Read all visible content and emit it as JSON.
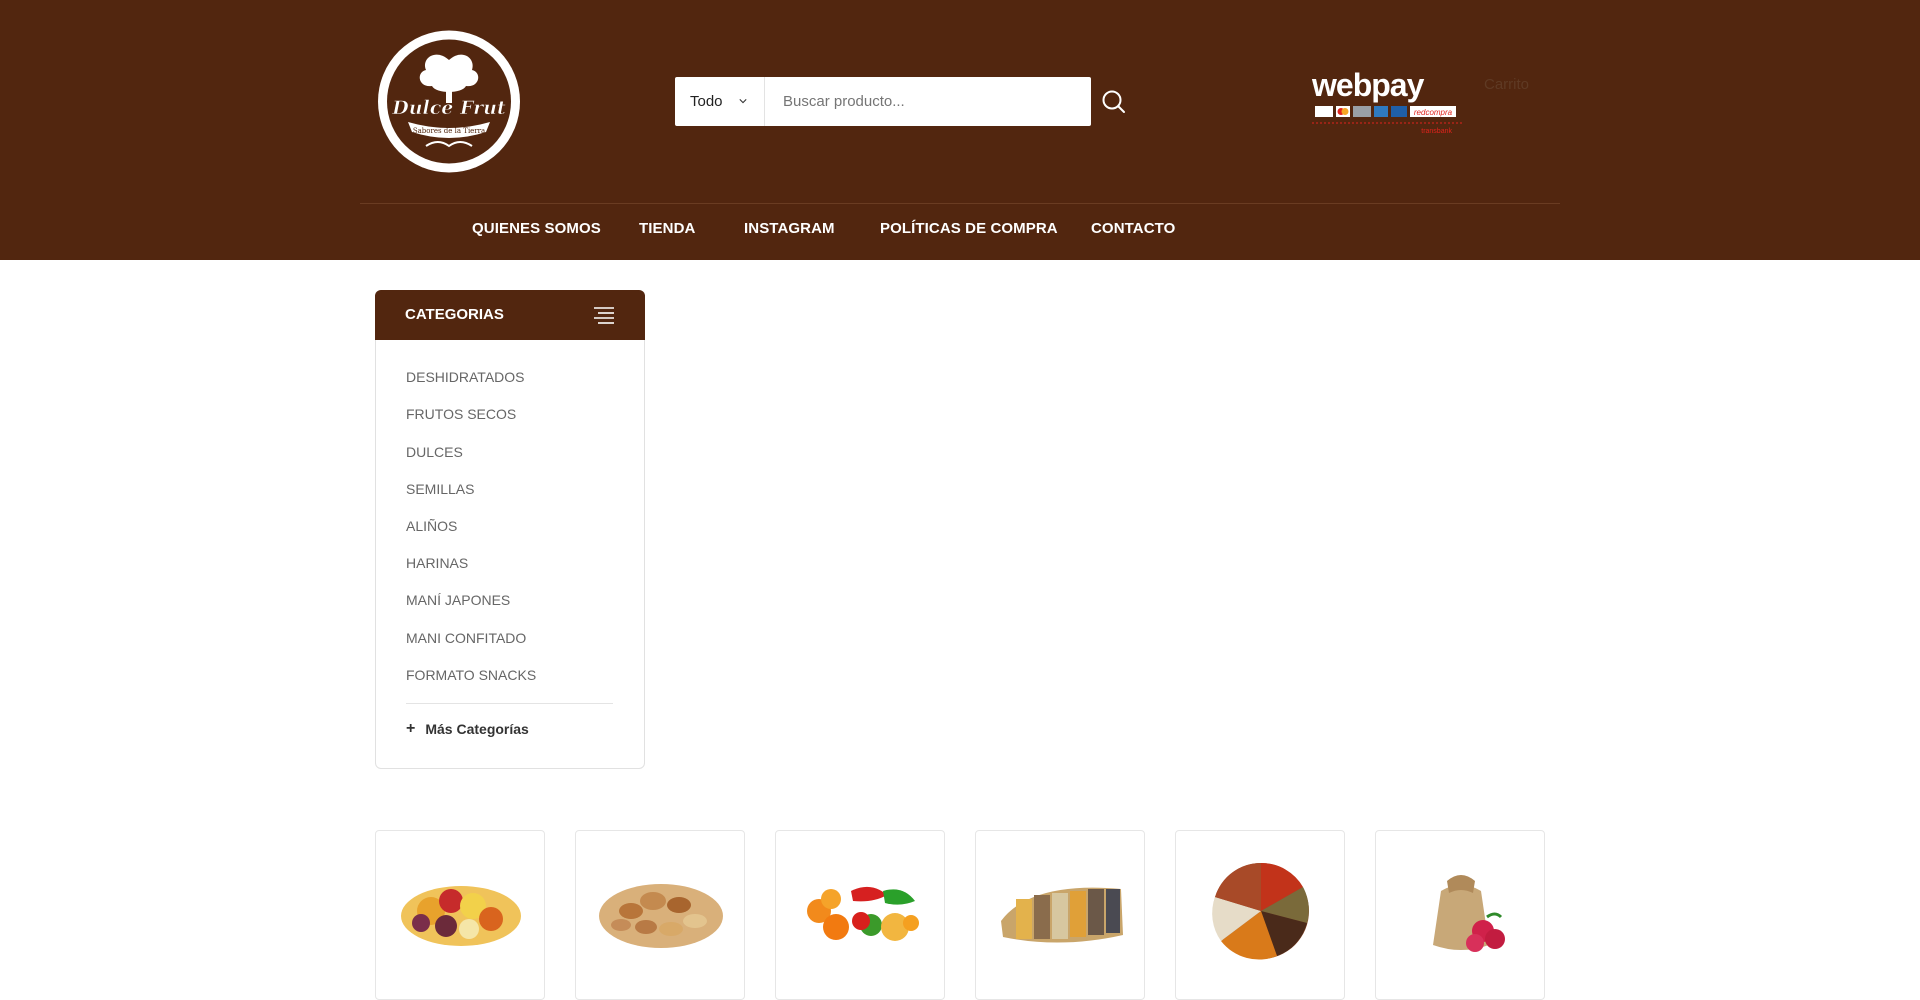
{
  "brand": {
    "logo_name": "Dulce Frut",
    "logo_tagline": "Sabores de la Tierra",
    "webpay_brand": "webpay",
    "webpay_sub": "transbank",
    "cart_text": "Carrito"
  },
  "search": {
    "category": "Todo",
    "placeholder": "Buscar producto..."
  },
  "nav": {
    "items": [
      "QUIENES SOMOS",
      "TIENDA",
      "INSTAGRAM",
      "POLÍTICAS DE COMPRA",
      "CONTACTO"
    ]
  },
  "categories": {
    "title": "CATEGORIAS",
    "items": [
      "DESHIDRATADOS",
      "FRUTOS SECOS",
      "DULCES",
      "SEMILLAS",
      "ALIÑOS",
      "HARINAS",
      "MANÍ JAPONES",
      "MANI CONFITADO",
      "FORMATO SNACKS"
    ],
    "more": "Más Categorías"
  },
  "products": {
    "images": [
      "dried-fruit-mix-image",
      "nuts-mix-image",
      "gummy-candies-image",
      "seeds-assortment-image",
      "spices-assortment-image",
      "flour-sack-raspberries-image"
    ]
  },
  "colors": {
    "header_bg": "#52260f",
    "accent_orange": "#f5a623"
  }
}
